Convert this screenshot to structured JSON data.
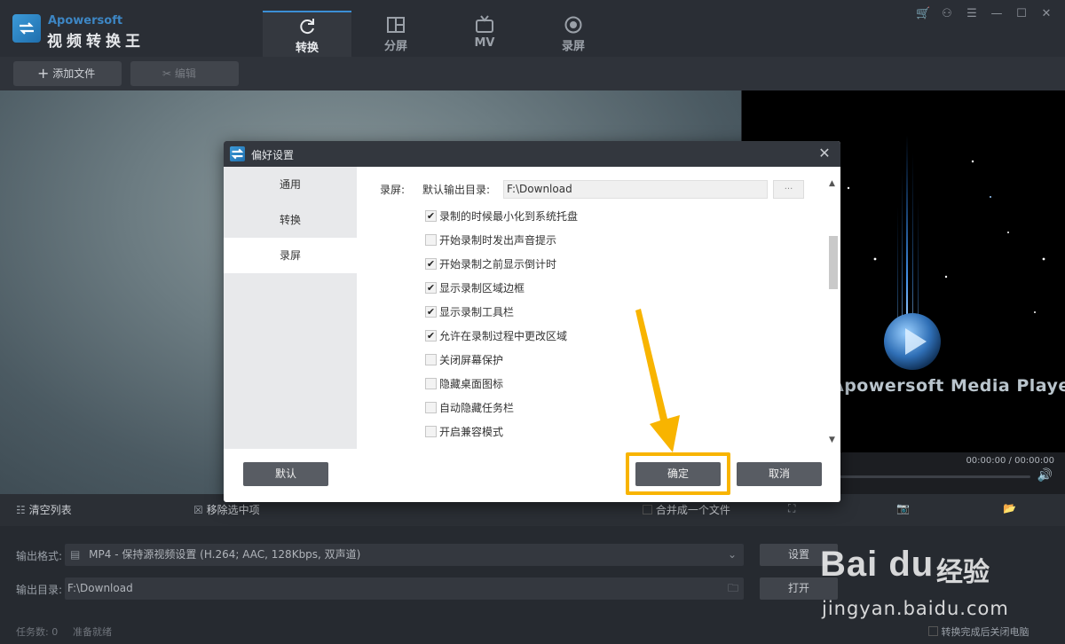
{
  "app": {
    "brand_en": "Apowersoft",
    "brand_cn": "视频转换王"
  },
  "tabs": [
    {
      "label": "转换",
      "icon": "refresh-icon",
      "active": true
    },
    {
      "label": "分屏",
      "icon": "split-screen-icon",
      "active": false
    },
    {
      "label": "MV",
      "icon": "tv-icon",
      "active": false
    },
    {
      "label": "录屏",
      "icon": "record-icon",
      "active": false
    }
  ],
  "window_controls": [
    "cart-icon",
    "user-icon",
    "menu-icon",
    "minimize-icon",
    "maximize-icon",
    "close-icon"
  ],
  "toolbar": {
    "add_file": "添加文件",
    "edit": "编辑"
  },
  "player": {
    "title": "Apowersoft Media Player",
    "time": "00:00:00 / 00:00:00"
  },
  "list_bar": {
    "clear_list": "清空列表",
    "remove_selected": "移除选中项",
    "merge": "合并成一个文件"
  },
  "output": {
    "format_label": "输出格式:",
    "format_value": "MP4 - 保持源视频设置 (H.264; AAC, 128Kbps, 双声道)",
    "settings_button": "设置",
    "dir_label": "输出目录:",
    "dir_value": "F:\\Download",
    "open_button": "打开"
  },
  "status": {
    "tasks": "任务数: 0",
    "ready": "准备就绪",
    "shutdown": "转换完成后关闭电脑"
  },
  "watermark": {
    "logo": "Bai du",
    "cn": "经验",
    "url": "jingyan.baidu.com"
  },
  "dialog": {
    "title": "偏好设置",
    "nav": [
      {
        "label": "通用",
        "active": false
      },
      {
        "label": "转换",
        "active": false
      },
      {
        "label": "录屏",
        "active": true
      }
    ],
    "section_label": "录屏:",
    "dir_label": "默认输出目录:",
    "dir_value": "F:\\Download",
    "browse": "···",
    "options": [
      {
        "label": "录制的时候最小化到系统托盘",
        "checked": true
      },
      {
        "label": "开始录制时发出声音提示",
        "checked": false
      },
      {
        "label": "开始录制之前显示倒计时",
        "checked": true
      },
      {
        "label": "显示录制区域边框",
        "checked": true
      },
      {
        "label": "显示录制工具栏",
        "checked": true
      },
      {
        "label": "允许在录制过程中更改区域",
        "checked": true
      },
      {
        "label": "关闭屏幕保护",
        "checked": false
      },
      {
        "label": "隐藏桌面图标",
        "checked": false
      },
      {
        "label": "自动隐藏任务栏",
        "checked": false
      },
      {
        "label": "开启兼容模式",
        "checked": false
      }
    ],
    "default_button": "默认",
    "ok_button": "确定",
    "cancel_button": "取消"
  },
  "colors": {
    "accent": "#3b8fd6",
    "highlight": "#f8b400"
  }
}
